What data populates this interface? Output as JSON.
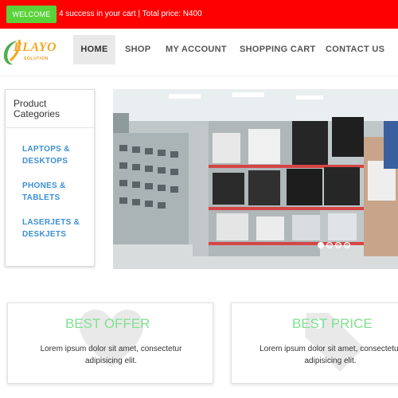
{
  "topbar": {
    "welcome_label": "WELCOME",
    "cart_status": "4 success in your cart | Total price: N400",
    "background_color": "#ff0000",
    "welcome_color": "#5ad33a"
  },
  "brand": {
    "name": "ELAYO",
    "tagline": "SOLUTION"
  },
  "nav": {
    "items": [
      {
        "label": "HOME",
        "active": true
      },
      {
        "label": "SHOP"
      },
      {
        "label": "MY ACCOUNT"
      },
      {
        "label": "SHOPPING CART"
      },
      {
        "label": "CONTACT US"
      }
    ]
  },
  "sidebar": {
    "title": "Product Categories",
    "items": [
      {
        "label": "LAPTOPS & DESKTOPS"
      },
      {
        "label": "PHONES & TABLETS"
      },
      {
        "label": "LASERJETS & DESKJETS"
      }
    ],
    "link_color": "#3a8fd6"
  },
  "slider": {
    "slide_count": 4,
    "active_index": 0
  },
  "features": [
    {
      "title": "BEST OFFER",
      "text": "Lorem ipsum dolor sit amet, consectetur adipisicing elit.",
      "icon": "heart-icon"
    },
    {
      "title": "BEST PRICE",
      "text": "Lorem ipsum dolor sit amet, consectetur adipisicing elit.",
      "icon": "tag-icon"
    }
  ],
  "accent_green": "#7ee28f"
}
